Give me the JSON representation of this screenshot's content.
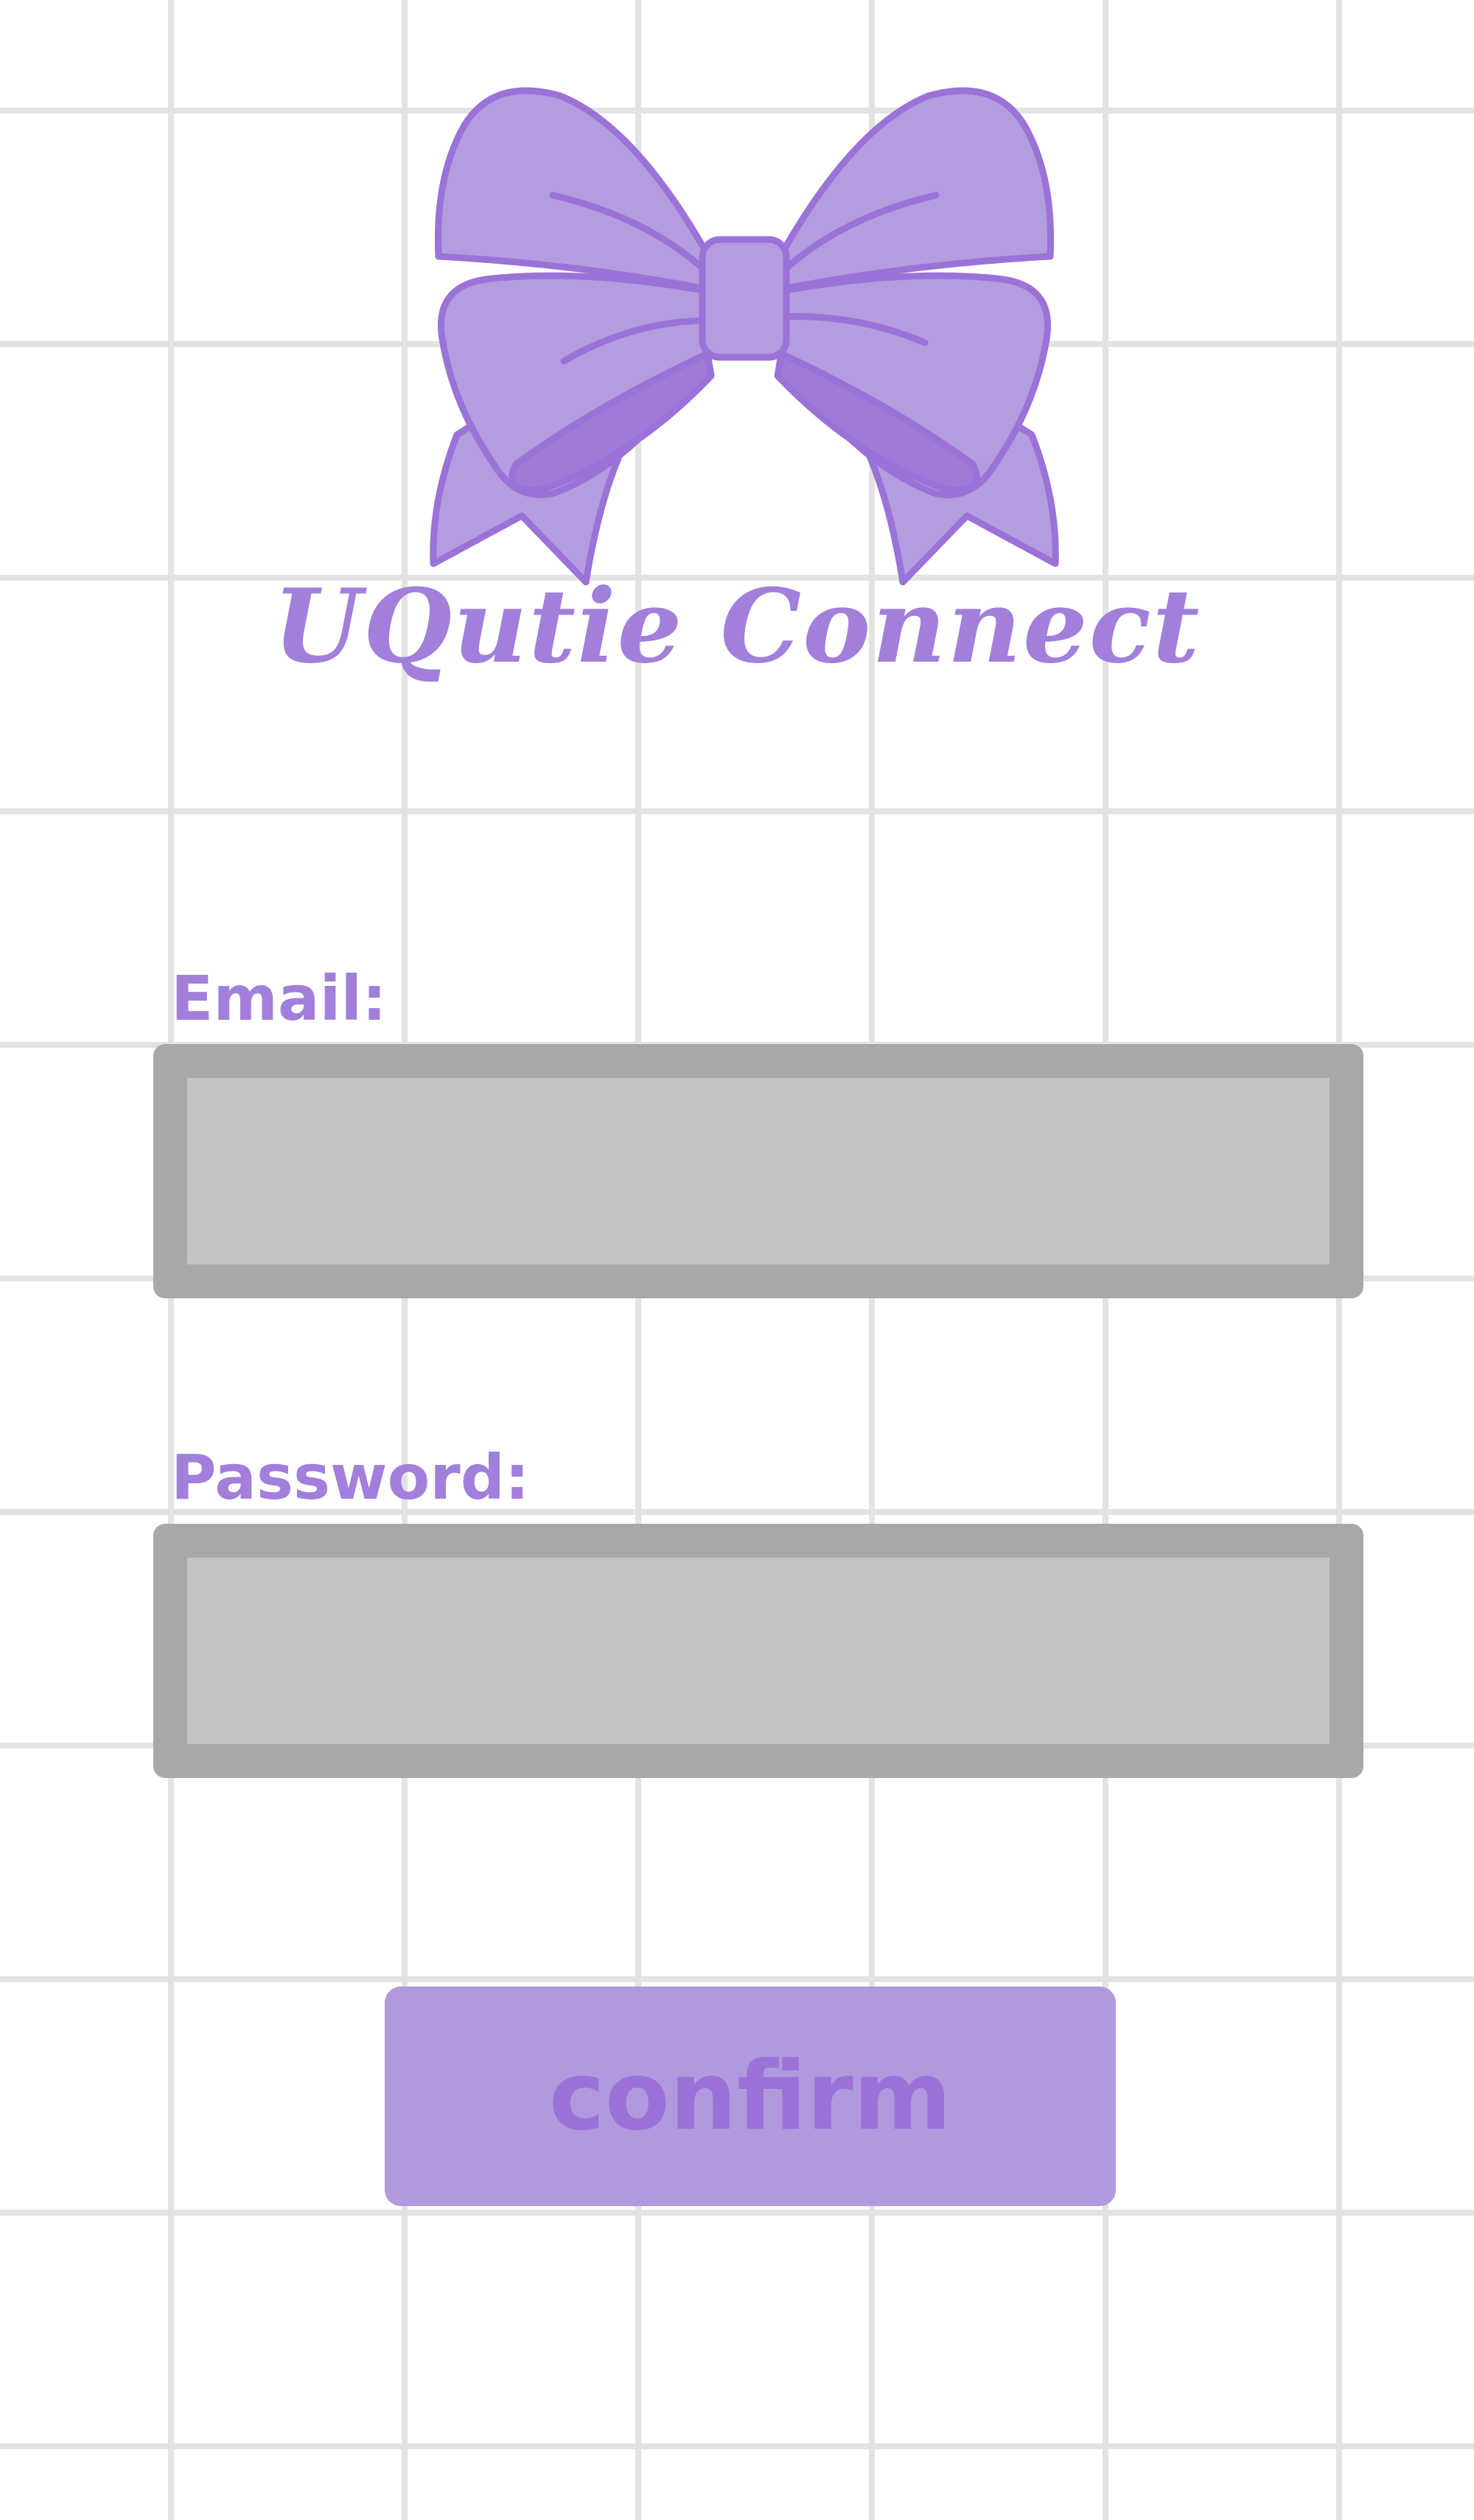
{
  "app": {
    "title": "UQutie Connect",
    "logo_icon": "bow-icon"
  },
  "form": {
    "email_label": "Email:",
    "email_value": "",
    "password_label": "Password:",
    "password_value": "",
    "confirm_label": "confirm"
  },
  "colors": {
    "accent": "#a17fdb",
    "bow_fill": "#b39ddf",
    "bow_shade": "#9e7bd8",
    "input_border": "#a8a8a8",
    "input_fill": "#c4c4c4",
    "button_fill": "#b199de",
    "button_text": "#9b72d7",
    "grid_line": "#e3e3e3"
  }
}
